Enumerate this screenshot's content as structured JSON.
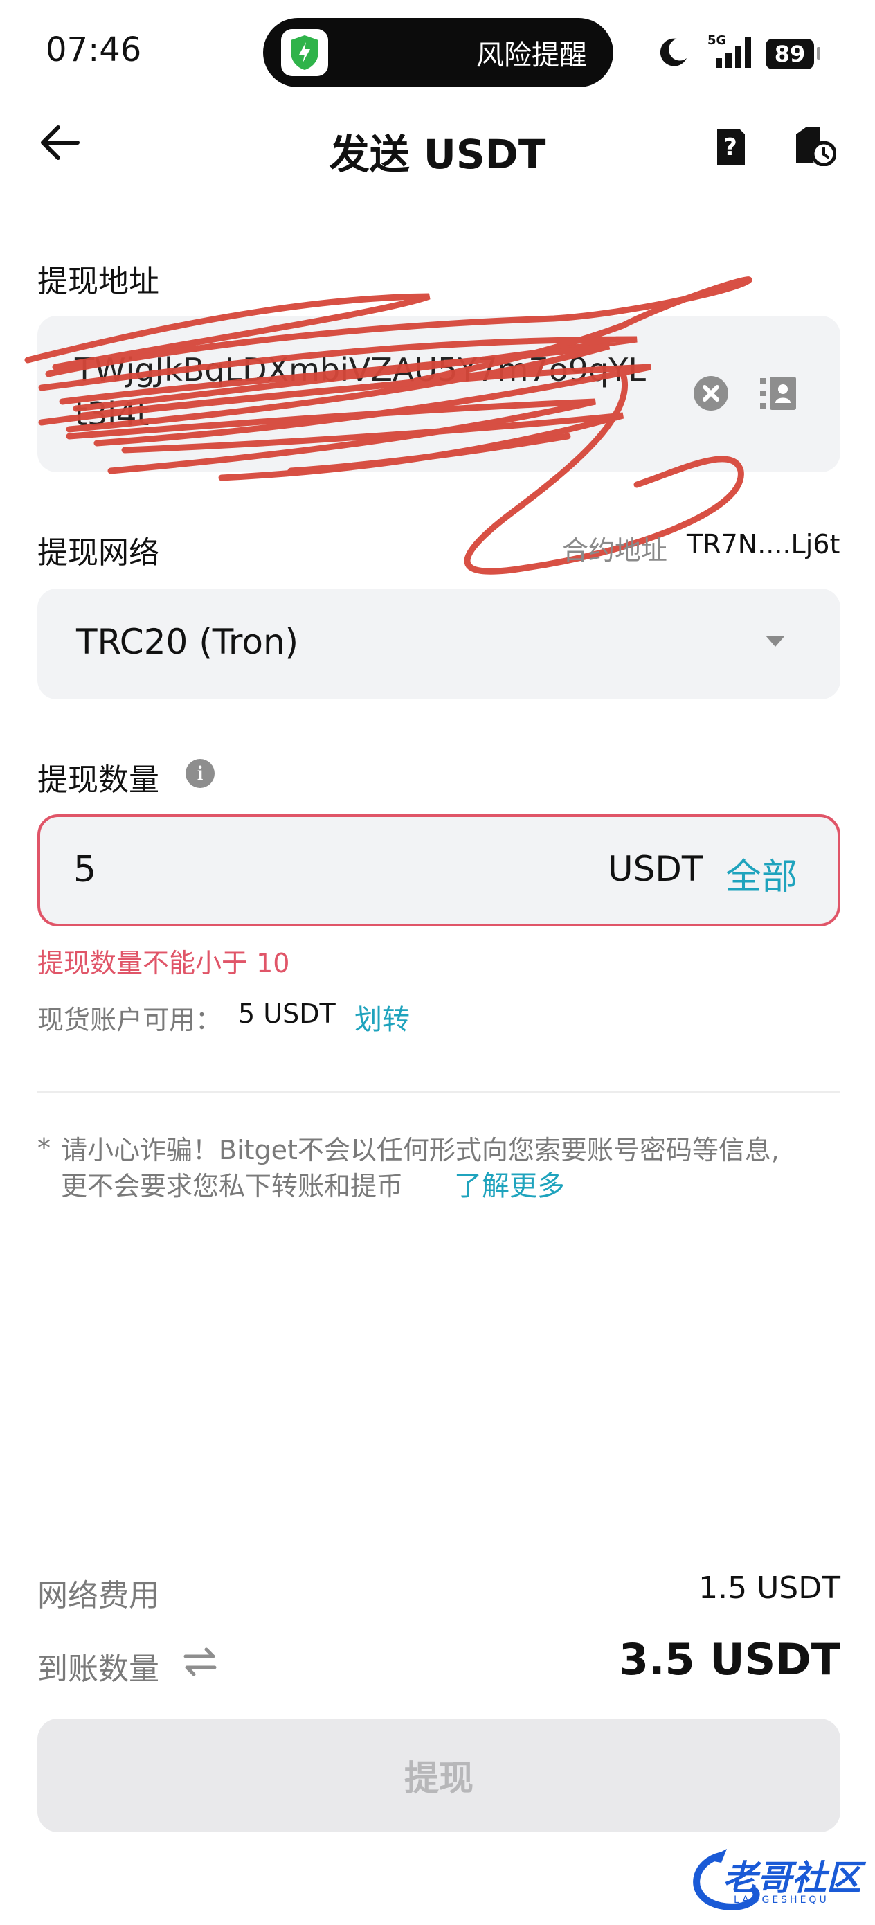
{
  "status_bar": {
    "time": "07:46",
    "alert_text": "风险提醒",
    "network": "5G",
    "battery": "89"
  },
  "header": {
    "title": "发送 USDT"
  },
  "address": {
    "label": "提现地址",
    "value": "TWjgJkBqLDXmbiVZAU5Y7m7o9qYLt3i4t"
  },
  "network": {
    "label": "提现网络",
    "contract_label": "合约地址",
    "contract_value": "TR7N....Lj6t",
    "selected": "TRC20 (Tron)"
  },
  "quantity": {
    "label": "提现数量",
    "info_glyph": "i",
    "value": "5",
    "unit": "USDT",
    "all_label": "全部",
    "error": "提现数量不能小于 10",
    "available_label": "现货账户可用：",
    "available_value": "5 USDT",
    "transfer_label": "划转"
  },
  "warning": {
    "star": "*",
    "line1": "请小心诈骗！Bitget不会以任何形式向您索要账号密码等信息,",
    "line2": "更不会要求您私下转账和提币",
    "learn_more": "了解更多"
  },
  "summary": {
    "fee_label": "网络费用",
    "fee_value": "1.5 USDT",
    "receive_label": "到账数量",
    "receive_value": "3.5 USDT"
  },
  "submit_label": "提现",
  "watermark": {
    "text": "老哥社区",
    "sub": "LAOGESHEQU"
  },
  "colors": {
    "accent": "#1fa3bd",
    "error": "#e05568",
    "field_bg": "#f2f3f5",
    "scribble": "#d6473a"
  },
  "icons": [
    "back-arrow-icon",
    "help-icon",
    "history-icon",
    "shield-icon",
    "moon-icon",
    "signal-icon",
    "clear-icon",
    "contacts-icon",
    "caret-down-icon",
    "info-icon",
    "swap-icon"
  ]
}
